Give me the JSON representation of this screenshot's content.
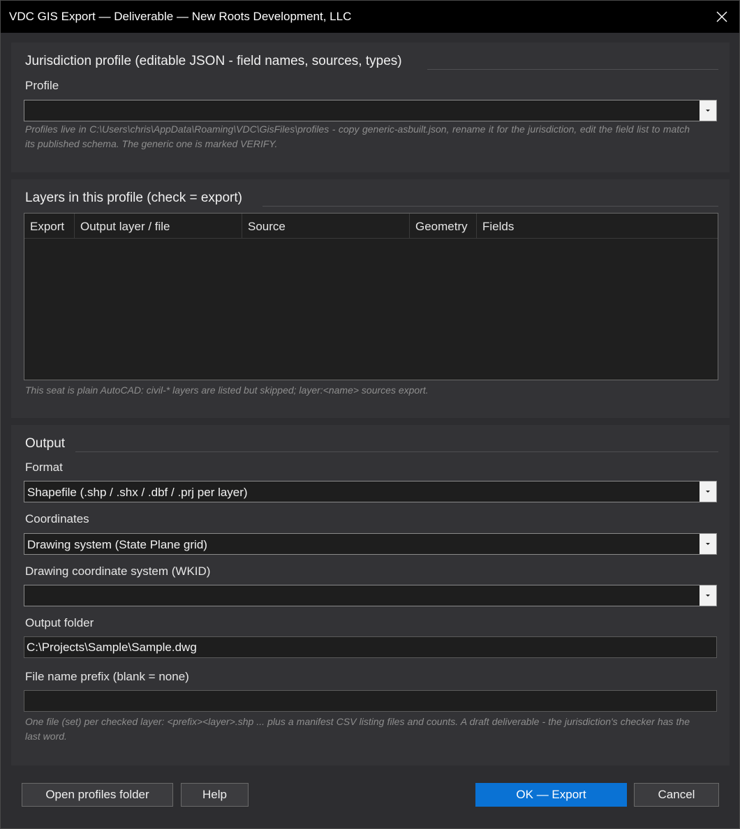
{
  "window": {
    "title": "VDC GIS Export — Deliverable — New Roots Development, LLC"
  },
  "jurisdiction": {
    "group_title": "Jurisdiction profile (editable JSON - field names, sources, types)",
    "profile_label": "Profile",
    "profile_value": "",
    "hint": "Profiles live in C:\\Users\\chris\\AppData\\Roaming\\VDC\\GisFiles\\profiles - copy generic-asbuilt.json, rename it for the jurisdiction, edit the field list to match its published schema. The generic one is marked VERIFY."
  },
  "layers": {
    "group_title": "Layers in this profile (check = export)",
    "columns": [
      "Export",
      "Output layer / file",
      "Source",
      "Geometry",
      "Fields"
    ],
    "rows": [],
    "hint": "This seat is plain AutoCAD: civil-* layers are listed but skipped; layer:<name> sources export."
  },
  "output": {
    "group_title": "Output",
    "format_label": "Format",
    "format_value": "Shapefile (.shp / .shx / .dbf / .prj per layer)",
    "coordinates_label": "Coordinates",
    "coordinates_value": "Drawing system (State Plane grid)",
    "wkid_label": "Drawing coordinate system (WKID)",
    "wkid_value": "",
    "folder_label": "Output folder",
    "folder_value": "C:\\Projects\\Sample\\Sample.dwg",
    "prefix_label": "File name prefix (blank = none)",
    "prefix_value": "",
    "hint": "One file (set) per checked layer: <prefix><layer>.shp ... plus a manifest CSV listing files and counts. A draft deliverable - the jurisdiction's checker has the last word."
  },
  "buttons": {
    "open_profiles": "Open profiles folder",
    "help": "Help",
    "ok": "OK — Export",
    "cancel": "Cancel"
  },
  "colors": {
    "accent": "#0a72d4",
    "titlebar": "#000000",
    "panel": "#333336"
  }
}
